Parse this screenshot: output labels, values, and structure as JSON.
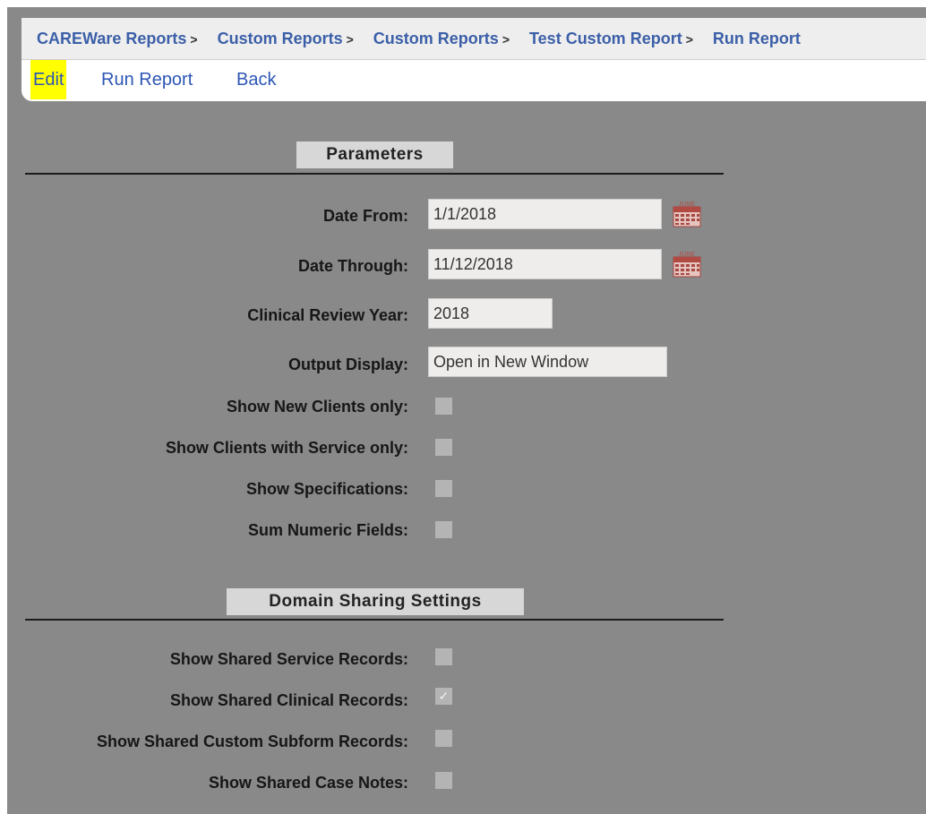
{
  "breadcrumb": [
    {
      "label": "CAREWare Reports"
    },
    {
      "label": "Custom Reports"
    },
    {
      "label": "Custom Reports"
    },
    {
      "label": "Test Custom Report"
    },
    {
      "label": "Run Report"
    }
  ],
  "breadcrumb_separator": ">",
  "actions": {
    "edit": "Edit",
    "run_report": "Run Report",
    "back": "Back"
  },
  "parameters": {
    "title": "Parameters",
    "date_from": {
      "label": "Date From:",
      "value": "1/1/2018"
    },
    "date_through": {
      "label": "Date Through:",
      "value": "11/12/2018"
    },
    "clinical_review_year": {
      "label": "Clinical Review Year:",
      "value": "2018"
    },
    "output_display": {
      "label": "Output Display:",
      "value": "Open in New Window"
    },
    "show_new_clients_only": {
      "label": "Show New Clients only:",
      "checked": false
    },
    "show_clients_with_service_only": {
      "label": "Show Clients with Service only:",
      "checked": false
    },
    "show_specifications": {
      "label": "Show Specifications:",
      "checked": false
    },
    "sum_numeric_fields": {
      "label": "Sum Numeric Fields:",
      "checked": false
    }
  },
  "domain_sharing": {
    "title": "Domain Sharing Settings",
    "show_shared_service_records": {
      "label": "Show Shared Service Records:",
      "checked": false
    },
    "show_shared_clinical_records": {
      "label": "Show Shared Clinical Records:",
      "checked": true
    },
    "show_shared_custom_subform_records": {
      "label": "Show Shared Custom Subform Records:",
      "checked": false
    },
    "show_shared_case_notes": {
      "label": "Show Shared Case Notes:",
      "checked": false
    }
  },
  "colors": {
    "link": "#2d56b5",
    "highlight": "#ffff00",
    "background": "#898989"
  },
  "icons": {
    "calendar": "calendar-icon",
    "checkmark": "checkmark-icon"
  }
}
